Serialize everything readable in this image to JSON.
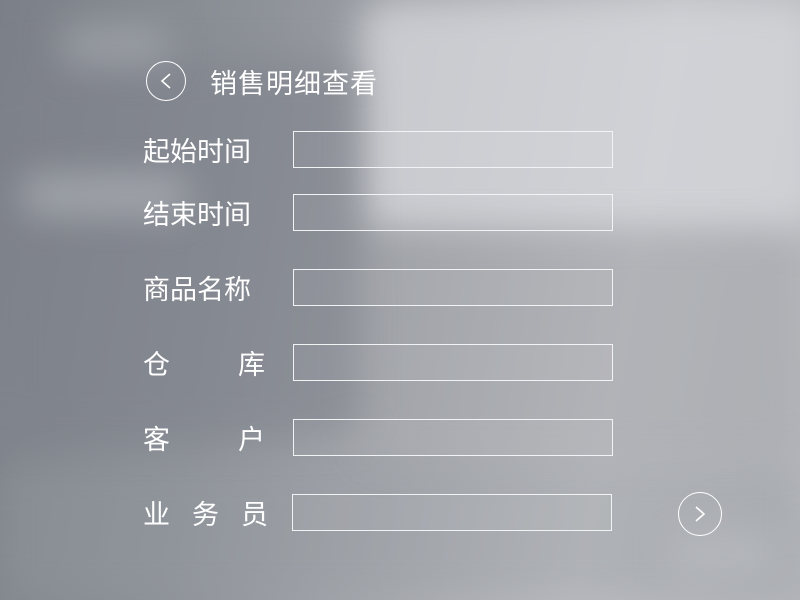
{
  "header": {
    "title": "销售明细查看",
    "back_icon": "chevron-left-icon"
  },
  "form": {
    "rows": [
      {
        "label_chars": [
          "起始时间"
        ],
        "value": "",
        "placeholder": ""
      },
      {
        "label_chars": [
          "结束时间"
        ],
        "value": "",
        "placeholder": ""
      },
      {
        "label_chars": [
          "商品名称"
        ],
        "value": "",
        "placeholder": ""
      },
      {
        "label_chars": [
          "仓",
          "库"
        ],
        "value": "",
        "placeholder": ""
      },
      {
        "label_chars": [
          "客",
          "户"
        ],
        "value": "",
        "placeholder": ""
      },
      {
        "label_chars": [
          "业",
          "务",
          "员"
        ],
        "value": "",
        "placeholder": ""
      }
    ]
  },
  "footer": {
    "next_icon": "chevron-right-icon"
  },
  "colors": {
    "text": "#ffffff",
    "field_border": "#f2f3f5"
  }
}
